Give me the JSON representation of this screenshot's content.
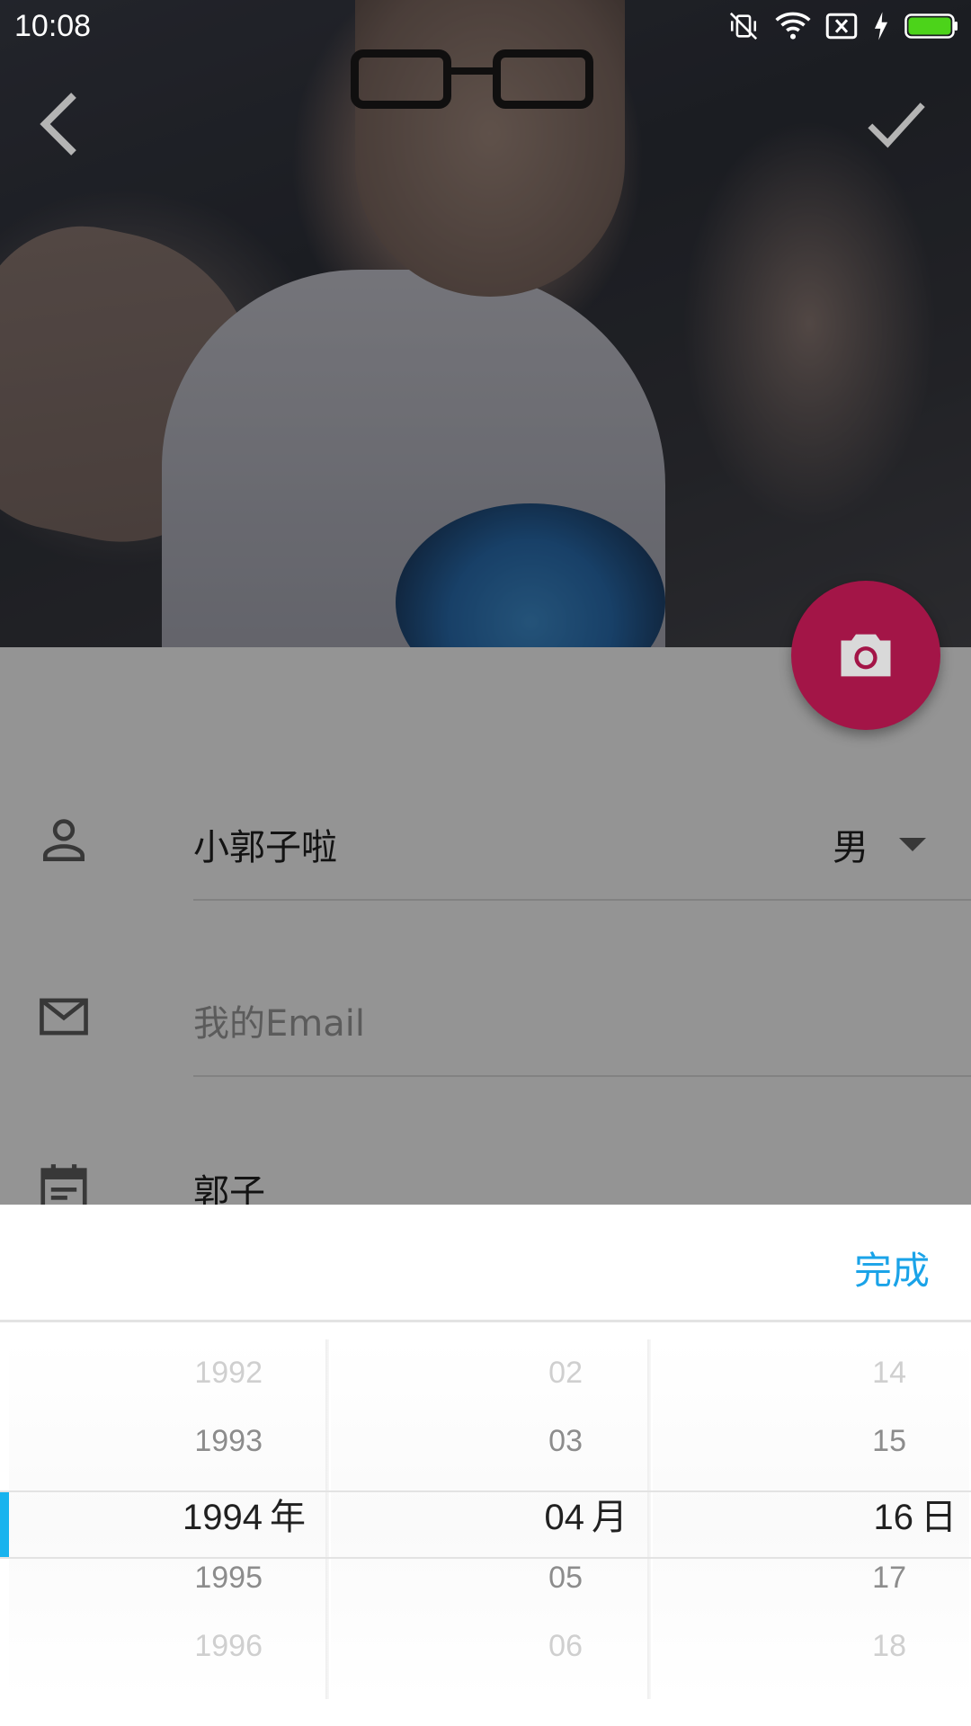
{
  "status_bar": {
    "time": "10:08"
  },
  "header": {
    "back_icon": "chevron-left-icon",
    "confirm_icon": "check-icon",
    "fab_icon": "camera-icon",
    "accent_color": "#a31547"
  },
  "form": {
    "name_value": "小郭子啦",
    "gender_value": "男",
    "email_placeholder": "我的Email",
    "birthday_value": "郭子"
  },
  "picker": {
    "done_label": "完成",
    "done_color": "#1aa3e8",
    "year": {
      "items": [
        "1992",
        "1993",
        "1994",
        "1995",
        "1996"
      ],
      "selected": "1994",
      "unit": "年"
    },
    "month": {
      "items": [
        "02",
        "03",
        "04",
        "05",
        "06"
      ],
      "selected": "04",
      "unit": "月"
    },
    "day": {
      "items": [
        "14",
        "15",
        "16",
        "17",
        "18"
      ],
      "selected": "16",
      "unit": "日"
    }
  }
}
